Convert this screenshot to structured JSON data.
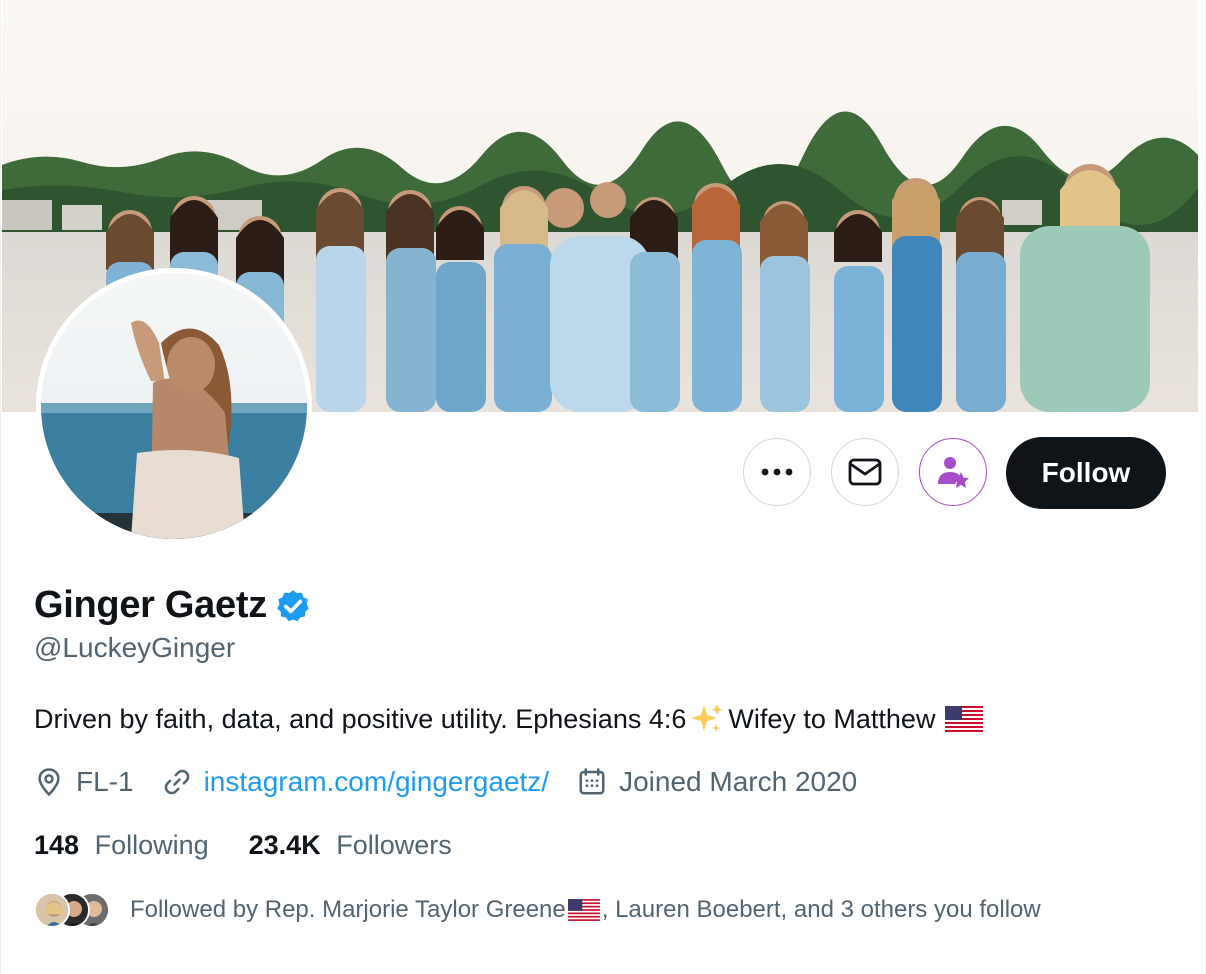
{
  "profile": {
    "name": "Ginger Gaetz",
    "handle": "@LuckeyGinger",
    "verified": true,
    "bio_text": "Driven by faith, data, and positive utility. Ephesians 4:6",
    "bio_text_2": "Wifey to Matthew",
    "bio_emojis": [
      "sparkles-emoji",
      "us-flag-emoji"
    ],
    "location": "FL-1",
    "website": "instagram.com/gingergaetz/",
    "joined": "Joined March 2020"
  },
  "stats": {
    "following_count": "148",
    "following_label": "Following",
    "followers_count": "23.4K",
    "followers_label": "Followers"
  },
  "actions": {
    "more_icon": "ellipsis-icon",
    "message_icon": "envelope-icon",
    "subscribe_icon": "person-star-icon",
    "follow_label": "Follow"
  },
  "followed_by": {
    "prefix": "Followed by Rep. Marjorie Taylor Greene",
    "suffix": ", Lauren Boebert, and 3 others you follow",
    "avatars_count": 3
  },
  "colors": {
    "text_primary": "#0f1419",
    "text_secondary": "#536471",
    "link": "#1d9bf0",
    "verified": "#1d9bf0",
    "follow_button_bg": "#0f1419",
    "subscribe_accent": "#a64dc9",
    "border": "#cfd9de"
  }
}
